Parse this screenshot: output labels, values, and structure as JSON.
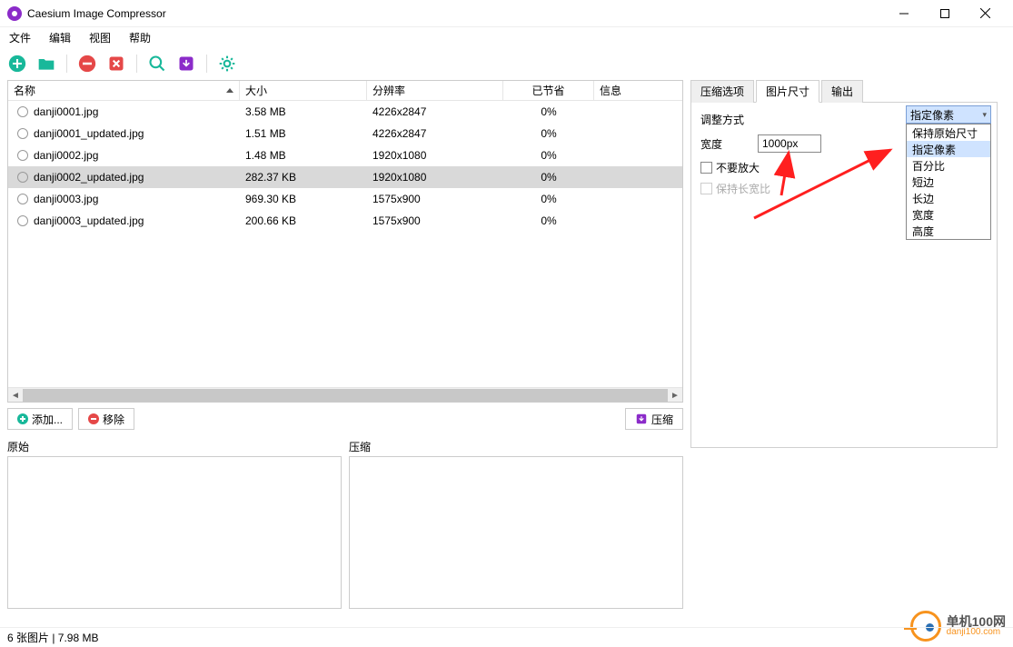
{
  "title": "Caesium Image Compressor",
  "menu": [
    "文件",
    "编辑",
    "视图",
    "帮助"
  ],
  "table": {
    "cols": [
      "名称",
      "大小",
      "分辨率",
      "已节省",
      "信息"
    ],
    "widths": [
      255,
      140,
      150,
      100,
      85
    ],
    "rows": [
      {
        "name": "danji0001.jpg",
        "size": "3.58 MB",
        "res": "4226x2847",
        "saved": "0%",
        "info": ""
      },
      {
        "name": "danji0001_updated.jpg",
        "size": "1.51 MB",
        "res": "4226x2847",
        "saved": "0%",
        "info": ""
      },
      {
        "name": "danji0002.jpg",
        "size": "1.48 MB",
        "res": "1920x1080",
        "saved": "0%",
        "info": ""
      },
      {
        "name": "danji0002_updated.jpg",
        "size": "282.37 KB",
        "res": "1920x1080",
        "saved": "0%",
        "info": "",
        "selected": true
      },
      {
        "name": "danji0003.jpg",
        "size": "969.30 KB",
        "res": "1575x900",
        "saved": "0%",
        "info": ""
      },
      {
        "name": "danji0003_updated.jpg",
        "size": "200.66 KB",
        "res": "1575x900",
        "saved": "0%",
        "info": ""
      }
    ]
  },
  "buttons": {
    "add": "添加...",
    "remove": "移除",
    "compress": "压缩"
  },
  "preview": {
    "orig": "原始",
    "comp": "压缩"
  },
  "tabs": [
    "压缩选项",
    "图片尺寸",
    "输出"
  ],
  "activeTab": 1,
  "panel": {
    "mode_label": "调整方式",
    "width_label": "宽度",
    "width_value": "1000px",
    "no_enlarge": "不要放大",
    "keep_ratio": "保持长宽比"
  },
  "dropdown": {
    "selected": "指定像素",
    "options": [
      "保持原始尺寸",
      "指定像素",
      "百分比",
      "短边",
      "长边",
      "宽度",
      "高度"
    ],
    "highlight": 1
  },
  "status": "6 张图片 | 7.98 MB",
  "watermark": {
    "line1": "单机100网",
    "line2": "danji100.com"
  }
}
